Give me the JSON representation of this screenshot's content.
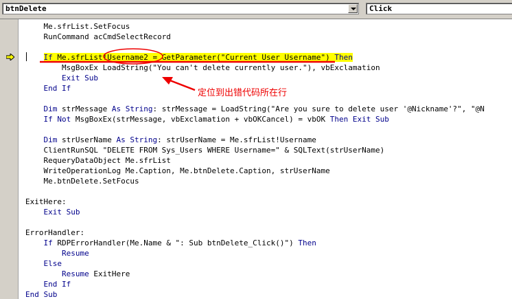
{
  "object_combo": {
    "value": "btnDelete"
  },
  "procedure_combo": {
    "value": "Click"
  },
  "code_lines": [
    {
      "indent": "    ",
      "parts": [
        {
          "t": "Me.sfrList.SetFocus"
        }
      ]
    },
    {
      "indent": "    ",
      "parts": [
        {
          "t": "RunCommand acCmdSelectRecord"
        }
      ]
    },
    {
      "indent": "",
      "parts": []
    },
    {
      "indent": "    ",
      "highlight": true,
      "parts": [
        {
          "t": "If",
          "kw": true
        },
        {
          "t": " Me.sfrList!Username2 = GetParameter(\"Current User Username\") "
        },
        {
          "t": "Then",
          "kw": true
        }
      ]
    },
    {
      "indent": "        ",
      "parts": [
        {
          "t": "MsgBoxEx LoadString(\"You can't delete currently user.\"), vbExclamation"
        }
      ]
    },
    {
      "indent": "        ",
      "parts": [
        {
          "t": "Exit Sub",
          "kw": true
        }
      ]
    },
    {
      "indent": "    ",
      "parts": [
        {
          "t": "End If",
          "kw": true
        }
      ]
    },
    {
      "indent": "",
      "parts": []
    },
    {
      "indent": "    ",
      "parts": [
        {
          "t": "Dim",
          "kw": true
        },
        {
          "t": " strMessage "
        },
        {
          "t": "As String",
          "kw": true
        },
        {
          "t": ": strMessage = LoadString(\"Are you sure to delete user '@Nickname'?\", \"@N"
        }
      ]
    },
    {
      "indent": "    ",
      "parts": [
        {
          "t": "If Not",
          "kw": true
        },
        {
          "t": " MsgBoxEx(strMessage, vbExclamation + vbOKCancel) = vbOK "
        },
        {
          "t": "Then Exit Sub",
          "kw": true
        }
      ]
    },
    {
      "indent": "",
      "parts": []
    },
    {
      "indent": "    ",
      "parts": [
        {
          "t": "Dim",
          "kw": true
        },
        {
          "t": " strUserName "
        },
        {
          "t": "As String",
          "kw": true
        },
        {
          "t": ": strUserName = Me.sfrList!Username"
        }
      ]
    },
    {
      "indent": "    ",
      "parts": [
        {
          "t": "ClientRunSQL \"DELETE FROM Sys_Users WHERE Username=\" & SQLText(strUserName)"
        }
      ]
    },
    {
      "indent": "    ",
      "parts": [
        {
          "t": "RequeryDataObject Me.sfrList"
        }
      ]
    },
    {
      "indent": "    ",
      "parts": [
        {
          "t": "WriteOperationLog Me.Caption, Me.btnDelete.Caption, strUserName"
        }
      ]
    },
    {
      "indent": "    ",
      "parts": [
        {
          "t": "Me.btnDelete.SetFocus"
        }
      ]
    },
    {
      "indent": "",
      "parts": []
    },
    {
      "indent": "",
      "parts": [
        {
          "t": "ExitHere:"
        }
      ]
    },
    {
      "indent": "    ",
      "parts": [
        {
          "t": "Exit Sub",
          "kw": true
        }
      ]
    },
    {
      "indent": "",
      "parts": []
    },
    {
      "indent": "",
      "parts": [
        {
          "t": "ErrorHandler:"
        }
      ]
    },
    {
      "indent": "    ",
      "parts": [
        {
          "t": "If",
          "kw": true
        },
        {
          "t": " RDPErrorHandler(Me.Name & \": Sub btnDelete_Click()\") "
        },
        {
          "t": "Then",
          "kw": true
        }
      ]
    },
    {
      "indent": "        ",
      "parts": [
        {
          "t": "Resume",
          "kw": true
        }
      ]
    },
    {
      "indent": "    ",
      "parts": [
        {
          "t": "Else",
          "kw": true
        }
      ]
    },
    {
      "indent": "        ",
      "parts": [
        {
          "t": "Resume",
          "kw": true
        },
        {
          "t": " ExitHere"
        }
      ]
    },
    {
      "indent": "    ",
      "parts": [
        {
          "t": "End If",
          "kw": true
        }
      ]
    },
    {
      "indent": "",
      "parts": [
        {
          "t": "End Sub",
          "kw": true
        }
      ]
    }
  ],
  "annotation": {
    "callout": "定位到出错代码所在行"
  },
  "colors": {
    "keyword": "#00008b",
    "highlight": "#ffff00",
    "annotation": "#ee0000"
  }
}
